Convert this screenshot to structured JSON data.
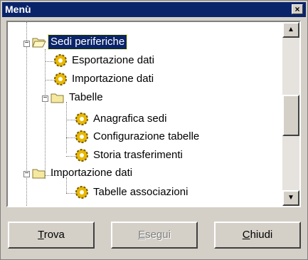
{
  "window": {
    "title": "Menù",
    "close_glyph": "×"
  },
  "tree": {
    "nodes": [
      {
        "label": "Sedi periferiche",
        "icon": "folder-open-icon"
      },
      {
        "label": "Esportazione dati",
        "icon": "gear-icon"
      },
      {
        "label": "Importazione dati",
        "icon": "gear-icon"
      },
      {
        "label": "Tabelle",
        "icon": "folder-open-icon"
      },
      {
        "label": "Anagrafica sedi",
        "icon": "gear-icon"
      },
      {
        "label": "Configurazione tabelle",
        "icon": "gear-icon"
      },
      {
        "label": "Storia trasferimenti",
        "icon": "gear-icon"
      },
      {
        "label": "Importazione dati",
        "icon": "folder-open-icon"
      },
      {
        "label": "Tabelle associazioni",
        "icon": "gear-icon"
      }
    ],
    "expander_symbol": "−"
  },
  "scrollbar": {
    "up": "▲",
    "down": "▼"
  },
  "buttons": {
    "trova": {
      "first": "T",
      "rest": "rova"
    },
    "esegui": {
      "first": "E",
      "rest": "segui"
    },
    "chiudi": {
      "first": "C",
      "rest": "hiudi"
    }
  }
}
